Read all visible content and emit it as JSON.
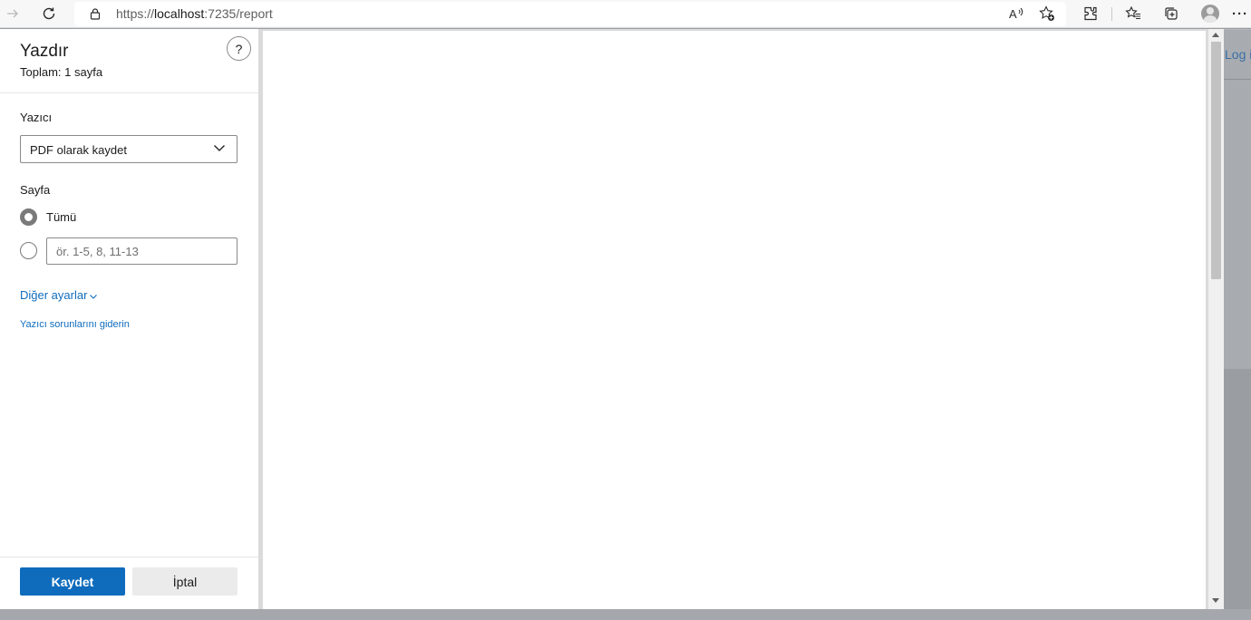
{
  "browser": {
    "url_prefix": "https://",
    "url_host": "localhost",
    "url_rest": ":7235/report",
    "icons": {
      "forward": "forward-arrow-icon",
      "refresh": "refresh-icon",
      "lock": "lock-icon",
      "read_aloud": "read-aloud-icon",
      "add_favorite": "add-favorite-icon",
      "extensions": "extensions-icon",
      "favorites": "favorites-icon",
      "collections": "collections-icon",
      "profile": "profile-avatar-icon",
      "more": "more-menu-icon"
    }
  },
  "background_page": {
    "link_text": "Log in"
  },
  "print": {
    "title": "Yazdır",
    "total": "Toplam: 1 sayfa",
    "help_label": "?",
    "printer_label": "Yazıcı",
    "printer_value": "PDF olarak kaydet",
    "pages_label": "Sayfa",
    "pages_all_label": "Tümü",
    "pages_all_selected": true,
    "pages_range_placeholder": "ör. 1-5, 8, 11-13",
    "more_settings": "Diğer ayarlar",
    "troubleshoot": "Yazıcı sorunlarını giderin",
    "save_button": "Kaydet",
    "cancel_button": "İptal"
  },
  "colors": {
    "accent": "#0f6cbd",
    "link": "#0f6cbd",
    "backdrop": "#9a9ea2"
  }
}
